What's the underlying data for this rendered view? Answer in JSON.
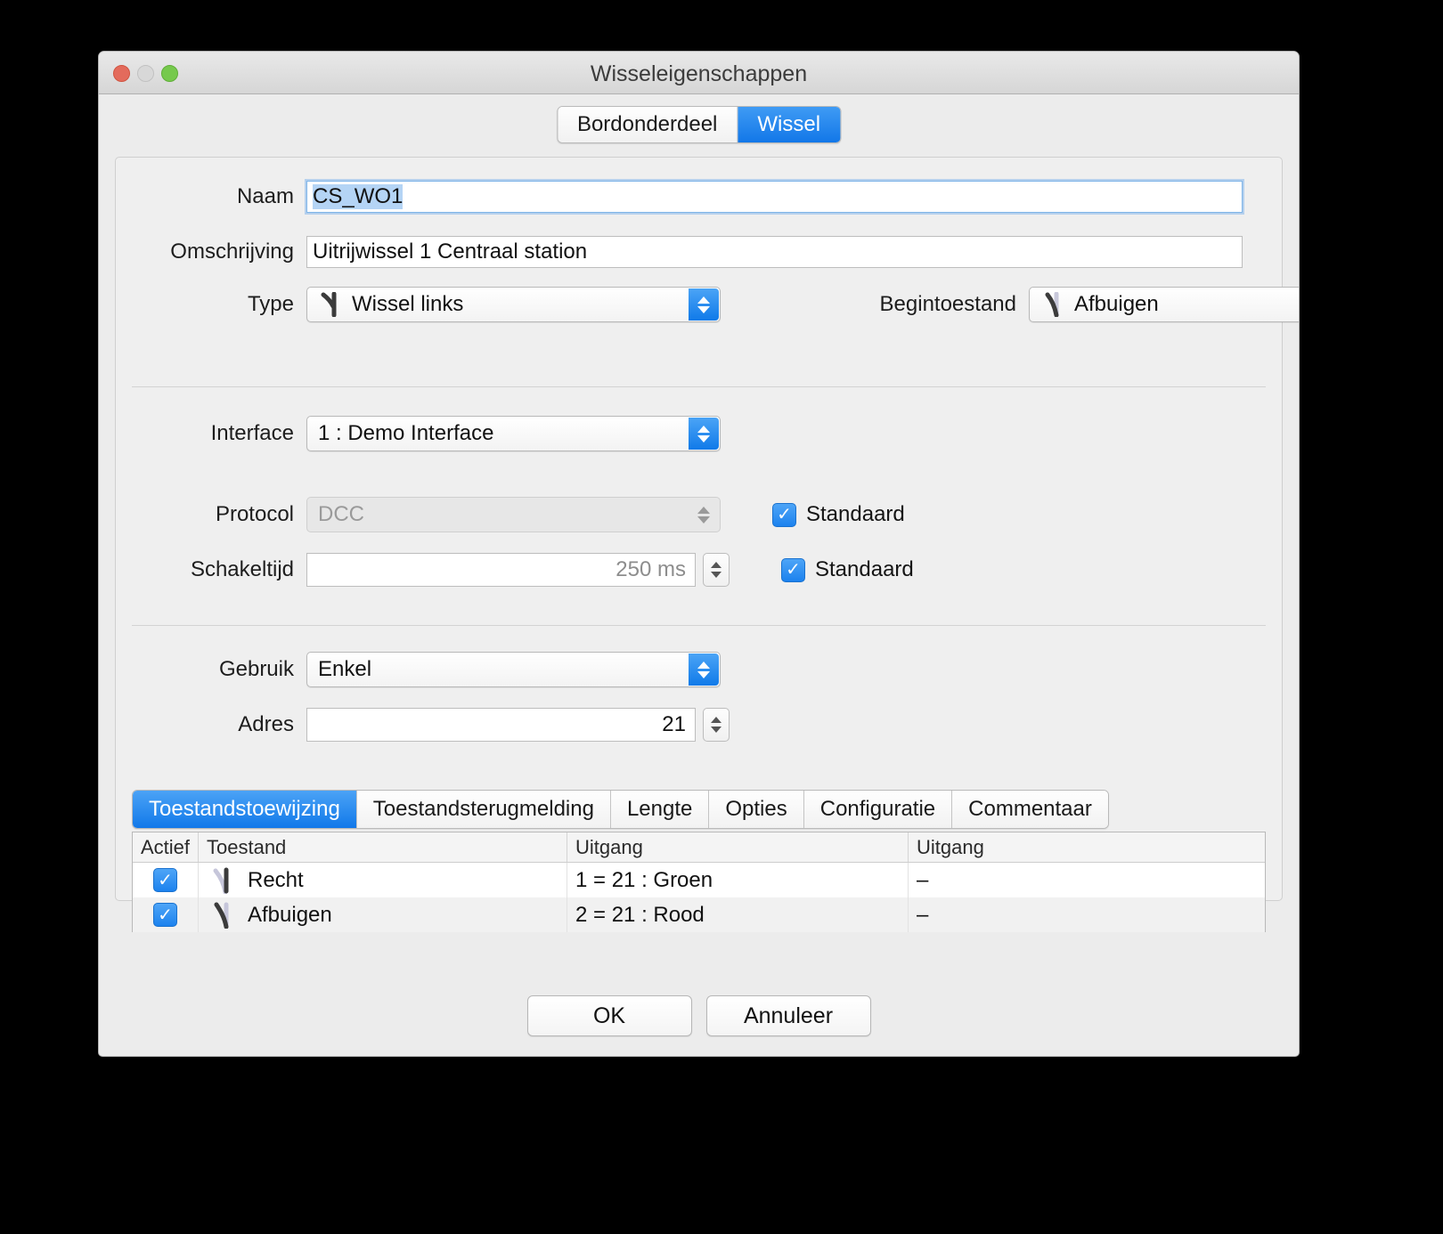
{
  "window": {
    "title": "Wisseleigenschappen",
    "traffic_lights": [
      "close",
      "minimize",
      "zoom"
    ]
  },
  "top_tabs": [
    {
      "label": "Bordonderdeel",
      "active": false
    },
    {
      "label": "Wissel",
      "active": true
    }
  ],
  "form": {
    "naam": {
      "label": "Naam",
      "value": "CS_WO1",
      "selected": true
    },
    "omschrijving": {
      "label": "Omschrijving",
      "value": "Uitrijwissel 1 Centraal station"
    },
    "type": {
      "label": "Type",
      "value": "Wissel links",
      "icon": "turnout-left-icon"
    },
    "begintoestand": {
      "label": "Begintoestand",
      "value": "Afbuigen",
      "icon": "turnout-diverging-icon"
    },
    "interface": {
      "label": "Interface",
      "value": "1 : Demo Interface"
    },
    "protocol": {
      "label": "Protocol",
      "value": "DCC",
      "disabled": true,
      "checkbox_label": "Standaard",
      "checkbox_checked": true
    },
    "schakeltijd": {
      "label": "Schakeltijd",
      "value": "250 ms",
      "checkbox_label": "Standaard",
      "checkbox_checked": true
    },
    "gebruik": {
      "label": "Gebruik",
      "value": "Enkel"
    },
    "adres": {
      "label": "Adres",
      "value": "21"
    }
  },
  "bottom_tabs": [
    {
      "label": "Toestandstoewijzing",
      "active": true
    },
    {
      "label": "Toestandsterugmelding",
      "active": false
    },
    {
      "label": "Lengte",
      "active": false
    },
    {
      "label": "Opties",
      "active": false
    },
    {
      "label": "Configuratie",
      "active": false
    },
    {
      "label": "Commentaar",
      "active": false
    }
  ],
  "table": {
    "headers": [
      "Actief",
      "Toestand",
      "Uitgang",
      "Uitgang"
    ],
    "rows": [
      {
        "actief": true,
        "icon": "turnout-straight-icon",
        "toestand": "Recht",
        "uitgang1": "1 = 21 : Groen",
        "uitgang2": "–"
      },
      {
        "actief": true,
        "icon": "turnout-diverging-icon",
        "toestand": "Afbuigen",
        "uitgang1": "2 = 21 : Rood",
        "uitgang2": "–"
      }
    ]
  },
  "footer": {
    "ok_label": "OK",
    "cancel_label": "Annuleer"
  },
  "colors": {
    "accent_blue": "#1178e9",
    "window_bg": "#ececec",
    "panel_bg": "#efefef",
    "selection_blue": "#b4d4f5"
  },
  "glyphs": {
    "checkmark": "✓"
  }
}
